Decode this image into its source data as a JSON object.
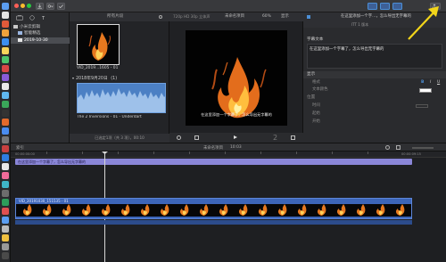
{
  "toolbar": {
    "accent": "#4c8fd6",
    "download_icon": "download-icon",
    "key_icon": "key-icon",
    "check_icon": "checkmark-icon"
  },
  "library": {
    "items": [
      {
        "label": "小米云剪辑"
      },
      {
        "label": "智能精选"
      },
      {
        "label": "2019-10-30"
      }
    ]
  },
  "browser": {
    "filter": "所有片段",
    "clip1_label": "VID_2019...1605 - 01",
    "date_group": "2018年9月20日",
    "date_count": "(1)",
    "clip2_label": "The 2 Inversions - 01 - Underdart",
    "status": "已选定1项（共 3 项），00:10"
  },
  "viewer": {
    "format": "720p HD 30p 立体声",
    "project_name": "未命名项目",
    "zoom": "60%",
    "view_label": "显示",
    "caption": "在这里添加一个字幕了，怎么导出无字幕的",
    "timecode": "2"
  },
  "inspector": {
    "tab_text": "在这里添加一个字...，怎么导出无字幕的",
    "title_label": "字幕文本",
    "subtitle_text": "在这里添加一个字幕了，怎么导出无字幕的",
    "role_label": "ITT 1 版本",
    "rows": [
      {
        "label": "显示"
      },
      {
        "label": "格式"
      },
      {
        "label": "文本颜色"
      },
      {
        "label": "位置"
      },
      {
        "label": "时间"
      },
      {
        "label": "起始"
      },
      {
        "label": "开始"
      }
    ]
  },
  "timeline": {
    "index_label": "索引",
    "project_label": "未命名项目",
    "duration": "10:03",
    "caption_clip": "在这里添加一个字幕了，怎么导出无字幕的",
    "video_clip": "VID_20191030_151535 - 01",
    "start_time": "00:00:00:00",
    "caption_end_time": "00:00:09:15",
    "accent_purple": "#8a86d8",
    "accent_blue": "#3c65b8"
  }
}
